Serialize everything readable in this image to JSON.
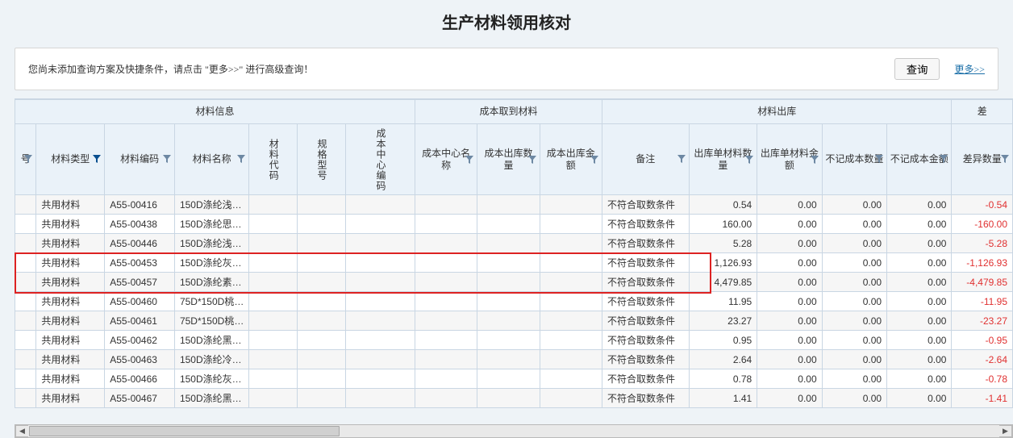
{
  "page_title": "生产材料领用核对",
  "filter_bar": {
    "message": "您尚未添加查询方案及快捷条件，请点击 \"更多>>\" 进行高级查询！",
    "query_button": "查询",
    "more_link": "更多>>"
  },
  "groups": {
    "info": "材料信息",
    "cost": "成本取到材料",
    "out": "材料出库",
    "diff": "差"
  },
  "columns": {
    "seq": "号",
    "mat_type": "材料类型",
    "mat_code": "材料编码",
    "mat_name": "材料名称",
    "mat_subcode": "材料代码",
    "spec": "规格型号",
    "cost_center_code": "成本中心编码",
    "cost_center_name": "成本中心名称",
    "cost_out_qty": "成本出库数量",
    "cost_out_amt": "成本出库金额",
    "remark": "备注",
    "out_bill_qty": "出库单材料数量",
    "out_bill_amt": "出库单材料金额",
    "nocost_qty": "不记成本数量",
    "nocost_amt": "不记成本金额",
    "diff_qty": "差异数量"
  },
  "rows": [
    {
      "mat_type": "共用材料",
      "mat_code": "A55-00416",
      "mat_name": "150D涤纶浅…",
      "remark": "不符合取数条件",
      "out_qty": "0.54",
      "out_amt": "0.00",
      "nocost_qty": "0.00",
      "nocost_amt": "0.00",
      "diff_qty": "-0.54"
    },
    {
      "mat_type": "共用材料",
      "mat_code": "A55-00438",
      "mat_name": "150D涤纶思…",
      "remark": "不符合取数条件",
      "out_qty": "160.00",
      "out_amt": "0.00",
      "nocost_qty": "0.00",
      "nocost_amt": "0.00",
      "diff_qty": "-160.00"
    },
    {
      "mat_type": "共用材料",
      "mat_code": "A55-00446",
      "mat_name": "150D涤纶浅…",
      "remark": "不符合取数条件",
      "out_qty": "5.28",
      "out_amt": "0.00",
      "nocost_qty": "0.00",
      "nocost_amt": "0.00",
      "diff_qty": "-5.28"
    },
    {
      "mat_type": "共用材料",
      "mat_code": "A55-00453",
      "mat_name": "150D涤纶灰…",
      "remark": "不符合取数条件",
      "out_qty": "1,126.93",
      "out_amt": "0.00",
      "nocost_qty": "0.00",
      "nocost_amt": "0.00",
      "diff_qty": "-1,126.93"
    },
    {
      "mat_type": "共用材料",
      "mat_code": "A55-00457",
      "mat_name": "150D涤纶素…",
      "remark": "不符合取数条件",
      "out_qty": "4,479.85",
      "out_amt": "0.00",
      "nocost_qty": "0.00",
      "nocost_amt": "0.00",
      "diff_qty": "-4,479.85"
    },
    {
      "mat_type": "共用材料",
      "mat_code": "A55-00460",
      "mat_name": "75D*150D桃…",
      "remark": "不符合取数条件",
      "out_qty": "11.95",
      "out_amt": "0.00",
      "nocost_qty": "0.00",
      "nocost_amt": "0.00",
      "diff_qty": "-11.95"
    },
    {
      "mat_type": "共用材料",
      "mat_code": "A55-00461",
      "mat_name": "75D*150D桃…",
      "remark": "不符合取数条件",
      "out_qty": "23.27",
      "out_amt": "0.00",
      "nocost_qty": "0.00",
      "nocost_amt": "0.00",
      "diff_qty": "-23.27"
    },
    {
      "mat_type": "共用材料",
      "mat_code": "A55-00462",
      "mat_name": "150D涤纶黑…",
      "remark": "不符合取数条件",
      "out_qty": "0.95",
      "out_amt": "0.00",
      "nocost_qty": "0.00",
      "nocost_amt": "0.00",
      "diff_qty": "-0.95"
    },
    {
      "mat_type": "共用材料",
      "mat_code": "A55-00463",
      "mat_name": "150D涤纶冷…",
      "remark": "不符合取数条件",
      "out_qty": "2.64",
      "out_amt": "0.00",
      "nocost_qty": "0.00",
      "nocost_amt": "0.00",
      "diff_qty": "-2.64"
    },
    {
      "mat_type": "共用材料",
      "mat_code": "A55-00466",
      "mat_name": "150D涤纶灰…",
      "remark": "不符合取数条件",
      "out_qty": "0.78",
      "out_amt": "0.00",
      "nocost_qty": "0.00",
      "nocost_amt": "0.00",
      "diff_qty": "-0.78"
    },
    {
      "mat_type": "共用材料",
      "mat_code": "A55-00467",
      "mat_name": "150D涤纶黑…",
      "remark": "不符合取数条件",
      "out_qty": "1.41",
      "out_amt": "0.00",
      "nocost_qty": "0.00",
      "nocost_amt": "0.00",
      "diff_qty": "-1.41"
    }
  ]
}
